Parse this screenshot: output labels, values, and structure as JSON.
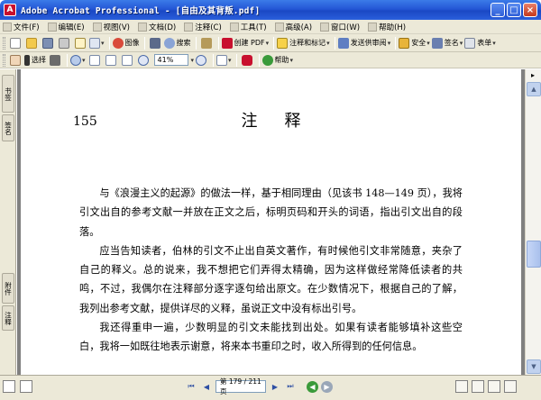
{
  "window": {
    "title": "Adobe Acrobat Professional - [自由及其背叛.pdf]",
    "minimize": "_",
    "maximize": "□",
    "close": "×"
  },
  "menubar": {
    "items": [
      "文件(F)",
      "编辑(E)",
      "视图(V)",
      "文档(D)",
      "注释(C)",
      "工具(T)",
      "高级(A)",
      "窗口(W)",
      "帮助(H)"
    ]
  },
  "toolbar1": {
    "search_label": "搜索",
    "create_pdf_label": "创建 PDF",
    "combine_label": "注释和标记",
    "send_review_label": "发送供审阅",
    "secure_label": "安全",
    "sign_label": "签名",
    "forms_label": "表单",
    "organize_label": "图像"
  },
  "toolbar2": {
    "select_label": "选择",
    "zoom_value": "41%",
    "help_label": "帮助"
  },
  "sidepanel": {
    "tab_top": "书签",
    "tab_top2": "签名",
    "tab_bottom": "附件",
    "tab_bottom2": "注释"
  },
  "document": {
    "page_number": "155",
    "heading": "注释",
    "paragraphs": [
      "与《浪漫主义的起源》的做法一样，基于相同理由（见该书 148—149 页），我将引文出自的参考文献一并放在正文之后，标明页码和开头的词语，指出引文出自的段落。",
      "应当告知读者，伯林的引文不止出自英文著作，有时候他引文非常随意，夹杂了自己的释义。总的说来，我不想把它们弄得太精确，因为这样做经常降低读者的共鸣，不过，我偶尔在注释部分逐字逐句给出原文。在少数情况下，根据自己的了解，我列出参考文献，提供详尽的义释，虽说正文中没有标出引号。",
      "我还得重申一遍，少数明显的引文未能找到出处。如果有读者能够填补这些空白，我将一如既往地表示谢意，将来本书重印之时，收入所得到的任何信息。"
    ]
  },
  "statusbar": {
    "page_field": "第 179 / 211 页",
    "first": "⏮",
    "prev": "◀",
    "next": "▶",
    "last": "⏭"
  }
}
